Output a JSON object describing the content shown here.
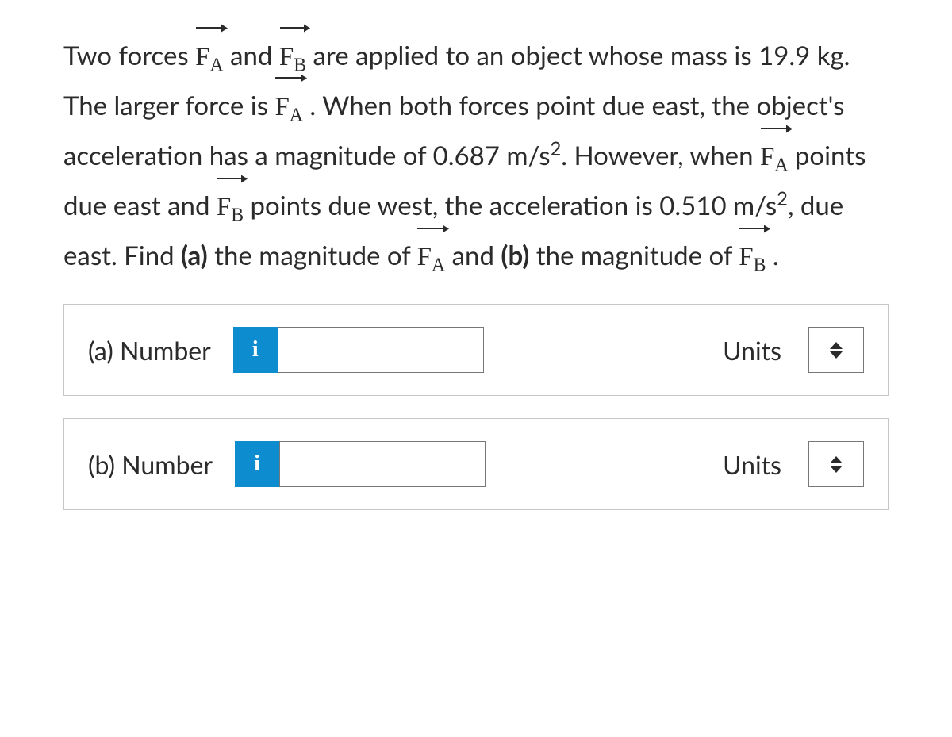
{
  "problem": {
    "t1": "Two forces ",
    "vFA": "F",
    "subA": "A",
    "t2": " and ",
    "vFB": "F",
    "subB": "B",
    "t3": " are applied to an object whose mass is ",
    "mass": "19.9 kg",
    "t4": ". The larger force is ",
    "t5": " . When both forces point due east, the object's acceleration has a magnitude of ",
    "acc1": "0.687 m/s",
    "sq": "2",
    "t6": ". However, when ",
    "t7": " points due east and ",
    "t8": " points due west, the acceleration is ",
    "acc2": "0.510 m/s",
    "t9": ", due east. Find ",
    "partA": "(a)",
    "t10": " the magnitude of ",
    "t11": " and ",
    "partB": "(b)",
    "t12": " the magnitude of ",
    "period": " ."
  },
  "answers": {
    "a": {
      "label": "(a)   Number",
      "info": "i",
      "value": "",
      "unitsLabel": "Units",
      "unitsValue": ""
    },
    "b": {
      "label": "(b)   Number",
      "info": "i",
      "value": "",
      "unitsLabel": "Units",
      "unitsValue": ""
    }
  }
}
